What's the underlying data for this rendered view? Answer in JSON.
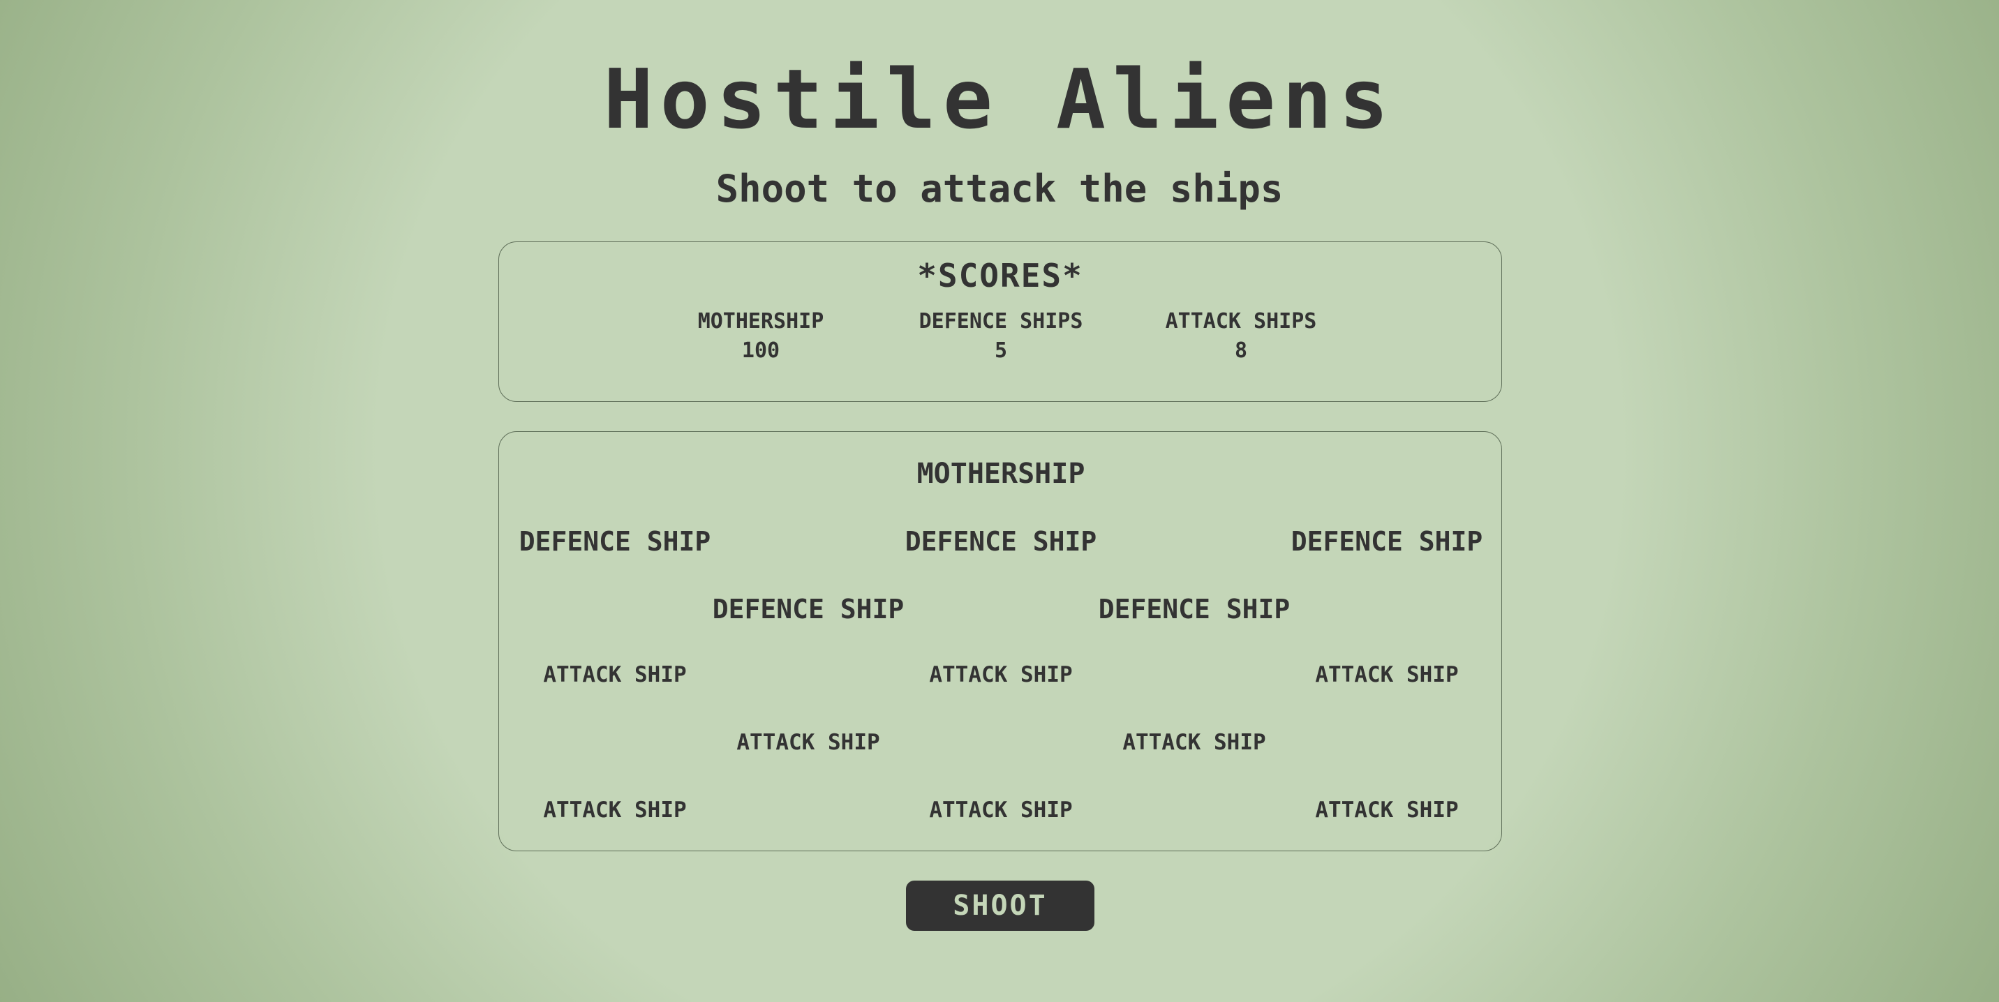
{
  "header": {
    "title": "Hostile Aliens",
    "subtitle": "Shoot to attack the ships"
  },
  "scores": {
    "title": "*SCORES*",
    "items": [
      {
        "label": "MOTHERSHIP",
        "value": "100"
      },
      {
        "label": "DEFENCE SHIPS",
        "value": "5"
      },
      {
        "label": "ATTACK SHIPS",
        "value": "8"
      }
    ]
  },
  "fleet": {
    "mothership": "MOTHERSHIP",
    "defence_ships": [
      "DEFENCE SHIP",
      "DEFENCE SHIP",
      "DEFENCE SHIP",
      "DEFENCE SHIP",
      "DEFENCE SHIP"
    ],
    "attack_ships": [
      "ATTACK SHIP",
      "ATTACK SHIP",
      "ATTACK SHIP",
      "ATTACK SHIP",
      "ATTACK SHIP",
      "ATTACK SHIP",
      "ATTACK SHIP",
      "ATTACK SHIP"
    ]
  },
  "controls": {
    "shoot_label": "SHOOT"
  },
  "colors": {
    "background": "#c4d6b8",
    "background_edge": "#8fa87d",
    "text": "#333333",
    "button_bg": "#333333",
    "button_text": "#c4d6b8"
  }
}
